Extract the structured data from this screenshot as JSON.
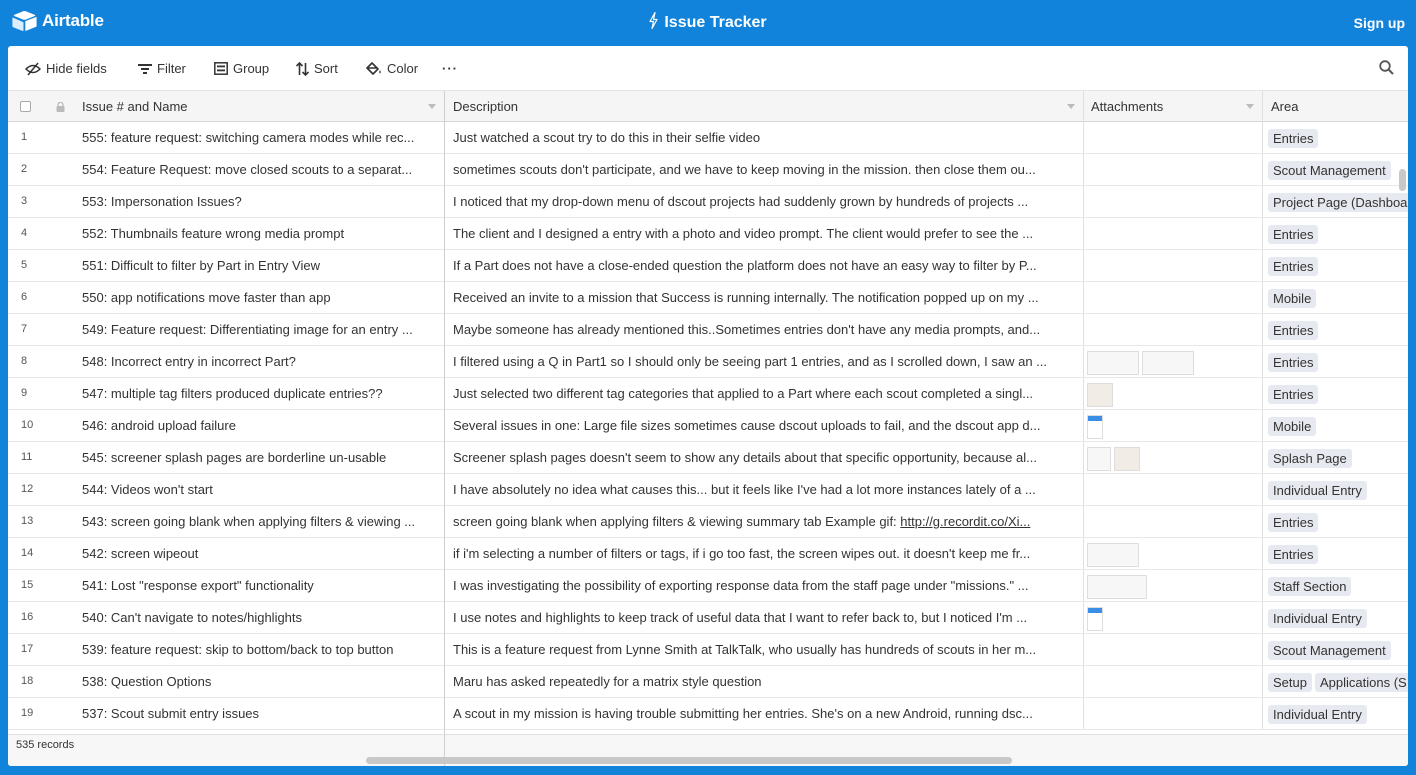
{
  "app": {
    "logo_text": "Airtable",
    "title": "Issue Tracker",
    "signup_label": "Sign up"
  },
  "toolbar": {
    "hide_fields": "Hide fields",
    "filter": "Filter",
    "group": "Group",
    "sort": "Sort",
    "color": "Color",
    "more": "···"
  },
  "columns": {
    "name": "Issue # and Name",
    "description": "Description",
    "attachments": "Attachments",
    "area": "Area"
  },
  "rows": [
    {
      "num": "1",
      "name": "555: feature request: switching camera modes while rec...",
      "desc": "Just watched a scout try to do this in their selfie video",
      "areas": [
        "Entries"
      ],
      "thumbs": []
    },
    {
      "num": "2",
      "name": "554: Feature Request: move closed scouts to a separat...",
      "desc": "sometimes scouts don't participate, and we have to keep moving in the mission. then close them ou...",
      "areas": [
        "Scout Management"
      ],
      "thumbs": []
    },
    {
      "num": "3",
      "name": "553: Impersonation Issues?",
      "desc": "I noticed that my drop-down menu of dscout projects had suddenly grown by hundreds of projects ...",
      "areas": [
        "Project Page (Dashboard)"
      ],
      "thumbs": []
    },
    {
      "num": "4",
      "name": "552: Thumbnails feature wrong media prompt",
      "desc": "The client and I designed a entry with a photo and video prompt. The client would prefer to see the ...",
      "areas": [
        "Entries"
      ],
      "thumbs": []
    },
    {
      "num": "5",
      "name": "551: Difficult to filter by Part in Entry View",
      "desc": "If a Part does not have a close-ended question the platform does not have an easy way to filter by P...",
      "areas": [
        "Entries"
      ],
      "thumbs": []
    },
    {
      "num": "6",
      "name": "550: app notifications move faster than app",
      "desc": "Received an invite to a mission that Success is running internally. The notification popped up on my ...",
      "areas": [
        "Mobile"
      ],
      "thumbs": []
    },
    {
      "num": "7",
      "name": "549: Feature request: Differentiating image for an entry ...",
      "desc": "Maybe someone has already mentioned this..Sometimes entries don't have any media prompts, and...",
      "areas": [
        "Entries"
      ],
      "thumbs": []
    },
    {
      "num": "8",
      "name": "548: Incorrect entry in incorrect Part?",
      "desc": "I filtered using a Q in Part1 so I should only be seeing part 1 entries, and as I scrolled down, I saw an ...",
      "areas": [
        "Entries"
      ],
      "thumbs": [
        "wide",
        "wide"
      ]
    },
    {
      "num": "9",
      "name": "547: multiple tag filters produced duplicate entries??",
      "desc": "Just selected two different tag categories that applied to a Part where each scout completed a singl...",
      "areas": [
        "Entries"
      ],
      "thumbs": [
        "small"
      ]
    },
    {
      "num": "10",
      "name": "546: android upload failure",
      "desc": "Several issues in one: Large file sizes sometimes cause dscout uploads to fail, and the dscout app d...",
      "areas": [
        "Mobile"
      ],
      "thumbs": [
        "phone"
      ]
    },
    {
      "num": "11",
      "name": "545: screener splash pages are borderline un-usable",
      "desc": "Screener splash pages doesn't seem to show any details about that specific opportunity, because al...",
      "areas": [
        "Splash Page"
      ],
      "thumbs": [
        "medium",
        "small"
      ]
    },
    {
      "num": "12",
      "name": "544: Videos won't start",
      "desc": "I have absolutely no idea what causes this... but it feels like I've had a lot more instances lately of a ...",
      "areas": [
        "Individual Entry"
      ],
      "thumbs": []
    },
    {
      "num": "13",
      "name": "543: screen going blank when applying filters & viewing ...",
      "desc": "screen going blank when applying filters & viewing summary tab Example gif: ",
      "link": "http://g.recordit.co/Xi...",
      "areas": [
        "Entries"
      ],
      "thumbs": []
    },
    {
      "num": "14",
      "name": "542: screen wipeout",
      "desc": "if i'm selecting a number of filters or tags, if i go too fast, the screen wipes out. it doesn't keep me fr...",
      "areas": [
        "Entries"
      ],
      "thumbs": [
        "wide"
      ]
    },
    {
      "num": "15",
      "name": "541: Lost \"response export\" functionality",
      "desc": "I was investigating the possibility of exporting response data from the staff page under \"missions.\" ...",
      "areas": [
        "Staff Section"
      ],
      "thumbs": [
        "xwide"
      ]
    },
    {
      "num": "16",
      "name": "540: Can't navigate to notes/highlights",
      "desc": "I use notes and highlights to keep track of useful data that I want to refer back to, but I noticed I'm ...",
      "areas": [
        "Individual Entry"
      ],
      "thumbs": [
        "phone"
      ]
    },
    {
      "num": "17",
      "name": "539: feature request: skip to bottom/back to top button",
      "desc": "This is a feature request from Lynne Smith at TalkTalk, who usually has hundreds of scouts in her m...",
      "areas": [
        "Scout Management"
      ],
      "thumbs": []
    },
    {
      "num": "18",
      "name": "538: Question Options",
      "desc": "Maru has asked repeatedly for a matrix style question",
      "areas": [
        "Setup",
        "Applications (S"
      ],
      "thumbs": []
    },
    {
      "num": "19",
      "name": "537: Scout submit entry issues",
      "desc": "A scout in my mission is having trouble submitting her entries. She's on a new Android, running dsc...",
      "areas": [
        "Individual Entry"
      ],
      "thumbs": []
    }
  ],
  "footer": {
    "records": "535 records"
  },
  "colors": {
    "brand": "#1283da",
    "tag_bg": "#e6e9f0"
  }
}
